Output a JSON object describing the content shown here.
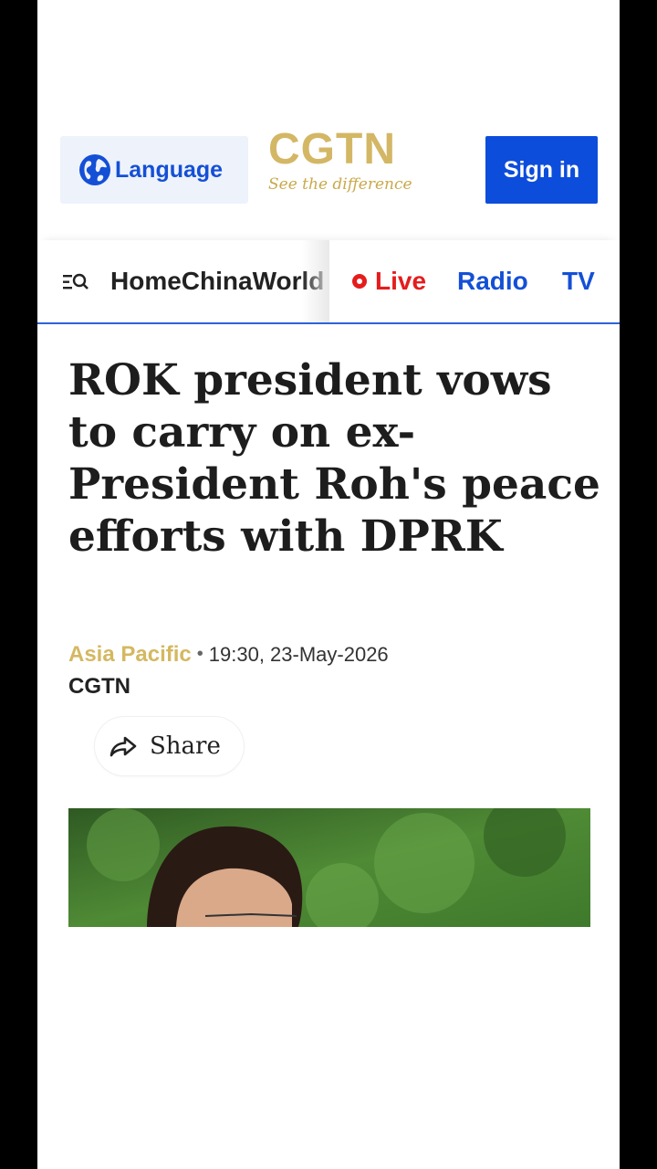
{
  "header": {
    "language_label": "Language",
    "logo_text": "CGTN",
    "logo_tagline": "See the difference",
    "signin_label": "Sign in"
  },
  "nav": {
    "scroll_items": [
      "Home",
      "China",
      "World"
    ],
    "live_label": "Live",
    "radio_label": "Radio",
    "tv_label": "TV"
  },
  "article": {
    "headline": "ROK president vows to carry on ex-President Roh's peace efforts with DPRK",
    "category": "Asia Pacific",
    "separator": "•",
    "timestamp": "19:30, 23-May-2026",
    "source": "CGTN",
    "share_label": "Share"
  },
  "colors": {
    "brand_blue": "#0d4ddb",
    "gold": "#d3b765",
    "live_red": "#e51c1c"
  }
}
